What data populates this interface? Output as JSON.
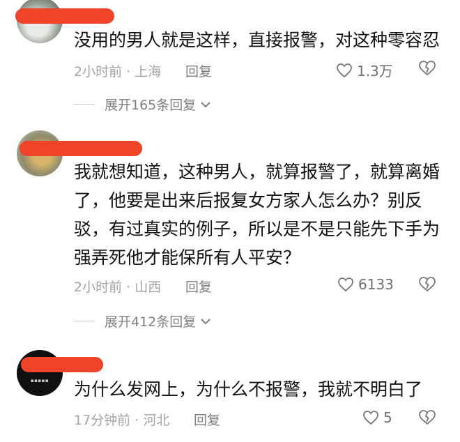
{
  "comments": [
    {
      "text": "没用的男人就是这样，直接报警，对这种零容忍",
      "time": "2小时前",
      "location": "上海",
      "reply_label": "回复",
      "likes": "1.3万",
      "expand_label": "展开165条回复"
    },
    {
      "text": "我就想知道，这种男人，就算报警了，就算离婚了，他要是出来后报复女方家人怎么办？别反驳，有过真实的例子，所以是不是只能先下手为强弄死他才能保所有人平安？",
      "time": "2小时前",
      "location": "山西",
      "reply_label": "回复",
      "likes": "6133",
      "expand_label": "展开412条回复"
    },
    {
      "text": "为什么发网上，为什么不报警，我就不明白了",
      "time": "17分钟前",
      "location": "河北",
      "reply_label": "回复",
      "likes": "5"
    }
  ],
  "separator": "·",
  "icons": {
    "like": "heart-outline-icon",
    "dislike": "broken-heart-icon",
    "expand": "chevron-down-icon"
  },
  "colors": {
    "redaction": "#f0442a",
    "meta": "#a3a3a3",
    "text": "#121212"
  }
}
